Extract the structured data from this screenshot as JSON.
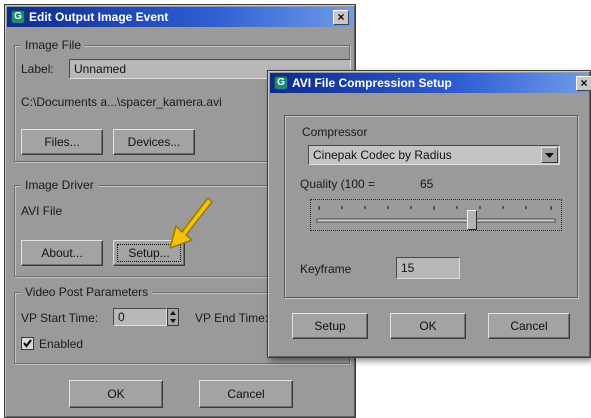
{
  "event_dialog": {
    "title": "Edit Output Image Event",
    "close_glyph": "×",
    "image_file_group": "Image File",
    "label_caption": "Label:",
    "label_value": "Unnamed",
    "file_path": "C:\\Documents a...\\spacer_kamera.avi",
    "files_button": "Files...",
    "devices_button": "Devices...",
    "image_driver_group": "Image Driver",
    "driver_name": "AVI File",
    "about_button": "About...",
    "setup_button": "Setup...",
    "video_post_group": "Video Post Parameters",
    "vp_start_caption": "VP Start Time:",
    "vp_start_value": "0",
    "vp_end_caption": "VP End Time:",
    "enabled_label": "Enabled",
    "enabled_checked": true,
    "ok_button": "OK",
    "cancel_button": "Cancel"
  },
  "avi_dialog": {
    "title": "AVI File Compression Setup",
    "close_glyph": "×",
    "compressor_caption": "Compressor",
    "compressor_value": "Cinepak Codec by Radius",
    "quality_caption": "Quality (100 =",
    "quality_value": "65",
    "quality_level": 65,
    "keyframe_caption": "Keyframe",
    "keyframe_value": "15",
    "setup_button": "Setup",
    "ok_button": "OK",
    "cancel_button": "Cancel"
  },
  "colors": {
    "dialog_bg": "#9a9a9a",
    "title_gradient_start": "#0d2a8c",
    "pointer_arrow": "#f2c20c"
  },
  "icons": {
    "app": "app-icon",
    "dropdown": "chevron-down-icon",
    "spinner": "spinner-arrows-icon",
    "checkbox": "checkmark-icon",
    "pointer": "pointer-arrow-icon"
  }
}
